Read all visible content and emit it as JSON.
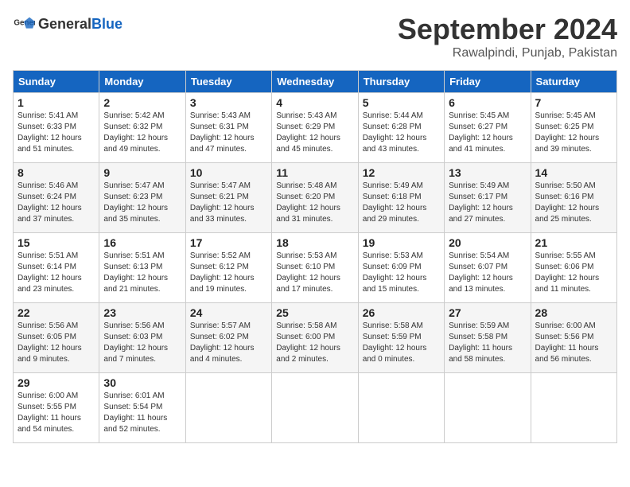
{
  "header": {
    "logo_general": "General",
    "logo_blue": "Blue",
    "month_title": "September 2024",
    "location": "Rawalpindi, Punjab, Pakistan"
  },
  "calendar": {
    "weekdays": [
      "Sunday",
      "Monday",
      "Tuesday",
      "Wednesday",
      "Thursday",
      "Friday",
      "Saturday"
    ],
    "weeks": [
      [
        {
          "day": "1",
          "sunrise": "5:41 AM",
          "sunset": "6:33 PM",
          "daylight": "12 hours and 51 minutes."
        },
        {
          "day": "2",
          "sunrise": "5:42 AM",
          "sunset": "6:32 PM",
          "daylight": "12 hours and 49 minutes."
        },
        {
          "day": "3",
          "sunrise": "5:43 AM",
          "sunset": "6:31 PM",
          "daylight": "12 hours and 47 minutes."
        },
        {
          "day": "4",
          "sunrise": "5:43 AM",
          "sunset": "6:29 PM",
          "daylight": "12 hours and 45 minutes."
        },
        {
          "day": "5",
          "sunrise": "5:44 AM",
          "sunset": "6:28 PM",
          "daylight": "12 hours and 43 minutes."
        },
        {
          "day": "6",
          "sunrise": "5:45 AM",
          "sunset": "6:27 PM",
          "daylight": "12 hours and 41 minutes."
        },
        {
          "day": "7",
          "sunrise": "5:45 AM",
          "sunset": "6:25 PM",
          "daylight": "12 hours and 39 minutes."
        }
      ],
      [
        {
          "day": "8",
          "sunrise": "5:46 AM",
          "sunset": "6:24 PM",
          "daylight": "12 hours and 37 minutes."
        },
        {
          "day": "9",
          "sunrise": "5:47 AM",
          "sunset": "6:23 PM",
          "daylight": "12 hours and 35 minutes."
        },
        {
          "day": "10",
          "sunrise": "5:47 AM",
          "sunset": "6:21 PM",
          "daylight": "12 hours and 33 minutes."
        },
        {
          "day": "11",
          "sunrise": "5:48 AM",
          "sunset": "6:20 PM",
          "daylight": "12 hours and 31 minutes."
        },
        {
          "day": "12",
          "sunrise": "5:49 AM",
          "sunset": "6:18 PM",
          "daylight": "12 hours and 29 minutes."
        },
        {
          "day": "13",
          "sunrise": "5:49 AM",
          "sunset": "6:17 PM",
          "daylight": "12 hours and 27 minutes."
        },
        {
          "day": "14",
          "sunrise": "5:50 AM",
          "sunset": "6:16 PM",
          "daylight": "12 hours and 25 minutes."
        }
      ],
      [
        {
          "day": "15",
          "sunrise": "5:51 AM",
          "sunset": "6:14 PM",
          "daylight": "12 hours and 23 minutes."
        },
        {
          "day": "16",
          "sunrise": "5:51 AM",
          "sunset": "6:13 PM",
          "daylight": "12 hours and 21 minutes."
        },
        {
          "day": "17",
          "sunrise": "5:52 AM",
          "sunset": "6:12 PM",
          "daylight": "12 hours and 19 minutes."
        },
        {
          "day": "18",
          "sunrise": "5:53 AM",
          "sunset": "6:10 PM",
          "daylight": "12 hours and 17 minutes."
        },
        {
          "day": "19",
          "sunrise": "5:53 AM",
          "sunset": "6:09 PM",
          "daylight": "12 hours and 15 minutes."
        },
        {
          "day": "20",
          "sunrise": "5:54 AM",
          "sunset": "6:07 PM",
          "daylight": "12 hours and 13 minutes."
        },
        {
          "day": "21",
          "sunrise": "5:55 AM",
          "sunset": "6:06 PM",
          "daylight": "12 hours and 11 minutes."
        }
      ],
      [
        {
          "day": "22",
          "sunrise": "5:56 AM",
          "sunset": "6:05 PM",
          "daylight": "12 hours and 9 minutes."
        },
        {
          "day": "23",
          "sunrise": "5:56 AM",
          "sunset": "6:03 PM",
          "daylight": "12 hours and 7 minutes."
        },
        {
          "day": "24",
          "sunrise": "5:57 AM",
          "sunset": "6:02 PM",
          "daylight": "12 hours and 4 minutes."
        },
        {
          "day": "25",
          "sunrise": "5:58 AM",
          "sunset": "6:00 PM",
          "daylight": "12 hours and 2 minutes."
        },
        {
          "day": "26",
          "sunrise": "5:58 AM",
          "sunset": "5:59 PM",
          "daylight": "12 hours and 0 minutes."
        },
        {
          "day": "27",
          "sunrise": "5:59 AM",
          "sunset": "5:58 PM",
          "daylight": "11 hours and 58 minutes."
        },
        {
          "day": "28",
          "sunrise": "6:00 AM",
          "sunset": "5:56 PM",
          "daylight": "11 hours and 56 minutes."
        }
      ],
      [
        {
          "day": "29",
          "sunrise": "6:00 AM",
          "sunset": "5:55 PM",
          "daylight": "11 hours and 54 minutes."
        },
        {
          "day": "30",
          "sunrise": "6:01 AM",
          "sunset": "5:54 PM",
          "daylight": "11 hours and 52 minutes."
        },
        null,
        null,
        null,
        null,
        null
      ]
    ]
  }
}
